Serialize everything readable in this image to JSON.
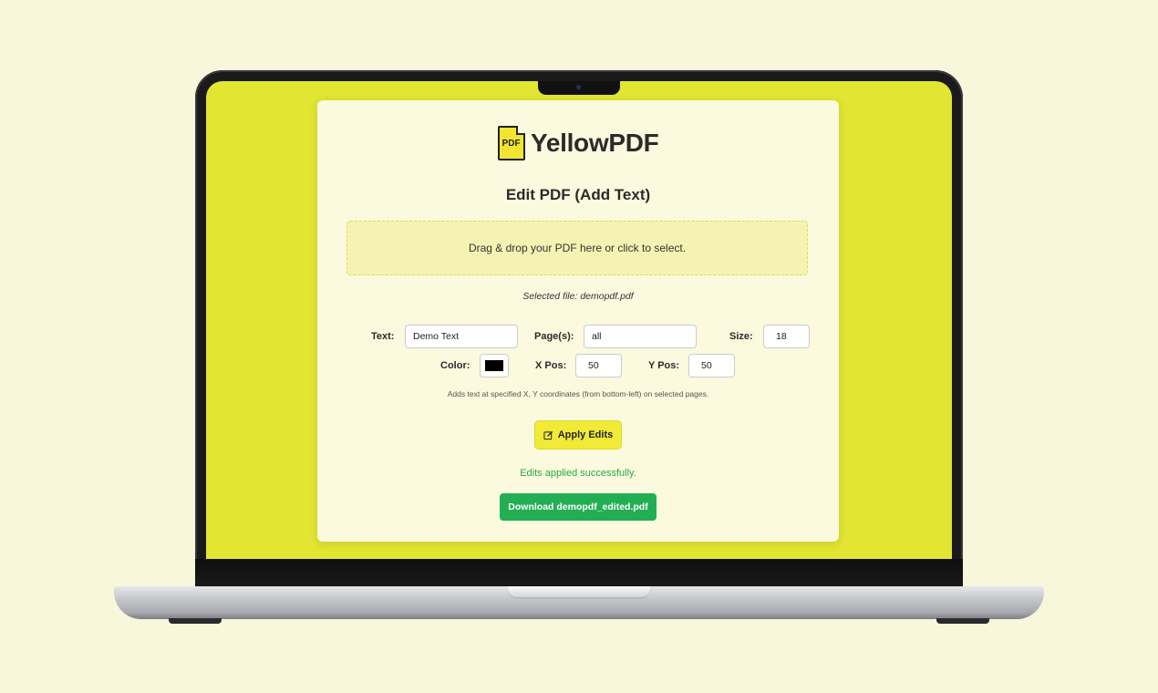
{
  "app": {
    "logo_badge": "PDF",
    "logo_text": "YellowPDF",
    "title": "Edit PDF (Add Text)"
  },
  "dropzone": {
    "text": "Drag & drop your PDF here or click to select."
  },
  "selected_file": "Selected file: demopdf.pdf",
  "form": {
    "text_label": "Text:",
    "text_value": "Demo Text",
    "pages_label": "Page(s):",
    "pages_value": "all",
    "size_label": "Size:",
    "size_value": "18",
    "color_label": "Color:",
    "color_value": "#000000",
    "xpos_label": "X Pos:",
    "xpos_value": "50",
    "ypos_label": "Y Pos:",
    "ypos_value": "50",
    "hint": "Adds text at specified X, Y coordinates (from bottom-left) on selected pages."
  },
  "apply_button": {
    "label": "Apply Edits",
    "icon": "edit-icon"
  },
  "status": {
    "message": "Edits applied successfully.",
    "color": "#27a84a"
  },
  "download_button": {
    "label": "Download demopdf_edited.pdf",
    "color": "#23ae53"
  },
  "colors": {
    "background": "#f8f7dc",
    "screen": "#e2e532",
    "card": "#fbf9de",
    "accent": "#f1ea36"
  }
}
